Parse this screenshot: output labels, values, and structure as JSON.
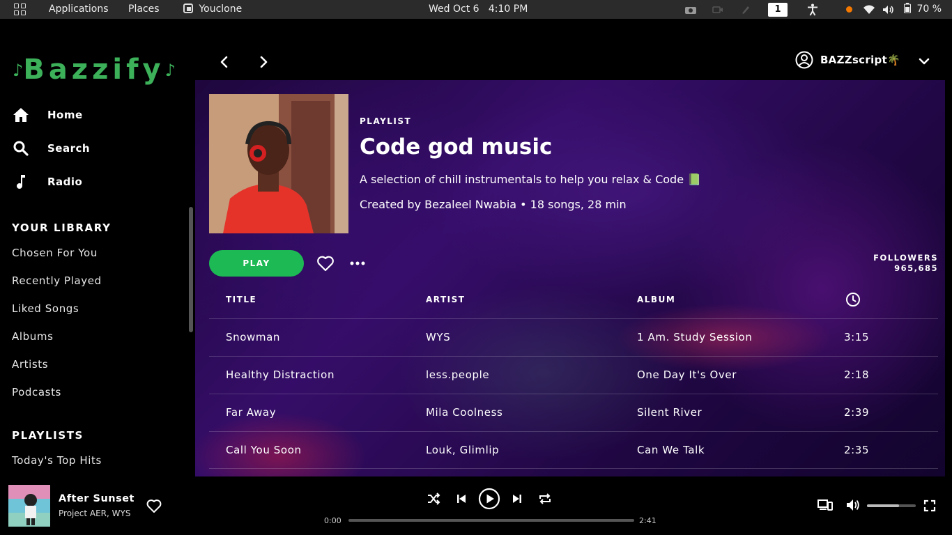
{
  "topbar": {
    "applications": "Applications",
    "places": "Places",
    "app_name": "Youclone",
    "clock": "Wed Oct 6   4:10 PM",
    "workspace": "1",
    "battery": "70 %"
  },
  "sidebar": {
    "logo": "Bazzify",
    "nav": [
      {
        "label": "Home",
        "icon": "home-icon"
      },
      {
        "label": "Search",
        "icon": "search-icon"
      },
      {
        "label": "Radio",
        "icon": "music-note-icon"
      }
    ],
    "library_title": "YOUR LIBRARY",
    "library": [
      "Chosen For You",
      "Recently Played",
      "Liked Songs",
      "Albums",
      "Artists",
      "Podcasts"
    ],
    "playlists_title": "PLAYLISTS",
    "playlists": [
      "Today's Top Hits"
    ]
  },
  "header": {
    "username": "BAZZscript🌴"
  },
  "playlist": {
    "type": "PLAYLIST",
    "title": "Code god music",
    "description": "A selection of chill instrumentals to help you relax & Code 📗",
    "meta": "Created by Bezaleel Nwabia • 18 songs, 28 min",
    "play_label": "PLAY",
    "followers_label": "FOLLOWERS",
    "followers_count": "965,685"
  },
  "tracks": {
    "headers": {
      "title": "TITLE",
      "artist": "ARTIST",
      "album": "ALBUM"
    },
    "rows": [
      {
        "title": "Snowman",
        "artist": "WYS",
        "album": "1 Am. Study Session",
        "duration": "3:15"
      },
      {
        "title": "Healthy Distraction",
        "artist": "less.people",
        "album": "One Day It's Over",
        "duration": "2:18"
      },
      {
        "title": "Far Away",
        "artist": "Mila Coolness",
        "album": "Silent River",
        "duration": "2:39"
      },
      {
        "title": "Call You Soon",
        "artist": "Louk, Glimlip",
        "album": "Can We Talk",
        "duration": "2:35"
      }
    ]
  },
  "player": {
    "track_title": "After Sunset",
    "track_artist": "Project AER, WYS",
    "time_current": "0:00",
    "time_total": "2:41",
    "progress": 0,
    "volume": 0.65
  },
  "colors": {
    "brand": "#3cb15a",
    "play_button": "#1db954"
  }
}
